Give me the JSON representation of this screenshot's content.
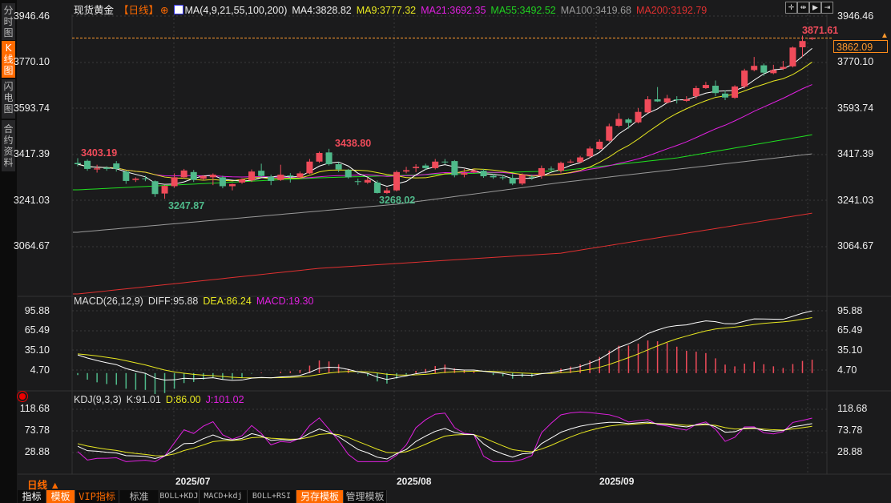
{
  "sidebar": {
    "tabs": [
      "分时图",
      "K线图",
      "闪电图",
      "合约资料"
    ],
    "active": 1
  },
  "header": {
    "instrument": "现货黄金",
    "period": "【日线】",
    "ma_label": "MA(4,9,21,55,100,200)",
    "ma4": "MA4:3828.82",
    "ma9": "MA9:3777.32",
    "ma21": "MA21:3692.35",
    "ma55": "MA55:3492.52",
    "ma100": "MA100:3419.68",
    "ma200": "MA200:3192.79"
  },
  "toolbar_icons": [
    "crosshair-icon",
    "zoom-range-icon",
    "play-icon",
    "jump-end-icon"
  ],
  "colors": {
    "up": "#f04b5a",
    "down": "#4fb98a",
    "ma4": "#ffffff",
    "ma9": "#e8e820",
    "ma21": "#e020e0",
    "ma55": "#20e020",
    "ma100": "#9a9a9a",
    "ma200": "#e03030",
    "accent": "#ff6a00"
  },
  "price_axis": {
    "ticks": [
      "3946.46",
      "3770.10",
      "3593.74",
      "3417.39",
      "3241.03",
      "3064.67"
    ],
    "current": "3862.09"
  },
  "annotations": {
    "high1": "3403.19",
    "high2": "3438.80",
    "low1": "3247.87",
    "low2": "3268.02",
    "high3": "3871.61"
  },
  "macd": {
    "label": "MACD(26,12,9)",
    "diff": "DIFF:95.88",
    "dea": "DEA:86.24",
    "macd": "MACD:19.30",
    "ticks": [
      "95.88",
      "65.49",
      "35.10",
      "4.70"
    ]
  },
  "kdj": {
    "label": "KDJ(9,3,3)",
    "k": "K:91.01",
    "d": "D:86.00",
    "j": "J:101.02",
    "ticks": [
      "118.68",
      "73.78",
      "28.88"
    ]
  },
  "dates": [
    "2025/07",
    "2025/08",
    "2025/09"
  ],
  "period_selector": "日线 ▲",
  "bottom_tabs": [
    "指标",
    "模板",
    "VIP指标",
    "标准",
    "BOLL+KDJ",
    "MACD+kdj",
    "BOLL+RSI",
    "另存模板",
    "管理模板"
  ],
  "chart_data": {
    "type": "candlestick",
    "title": "现货黄金 日线",
    "ylim": [
      2850,
      3960
    ],
    "candles_ohlc": [
      [
        3385,
        3403.19,
        3372,
        3380
      ],
      [
        3393,
        3398,
        3355,
        3362
      ],
      [
        3360,
        3378,
        3348,
        3364
      ],
      [
        3367,
        3372,
        3355,
        3362
      ],
      [
        3383,
        3392,
        3352,
        3362
      ],
      [
        3352,
        3356,
        3305,
        3316
      ],
      [
        3320,
        3330,
        3312,
        3325
      ],
      [
        3326,
        3336,
        3315,
        3324
      ],
      [
        3315,
        3318,
        3255,
        3266
      ],
      [
        3268,
        3300,
        3247.87,
        3297
      ],
      [
        3296,
        3345,
        3290,
        3330
      ],
      [
        3330,
        3362,
        3325,
        3356
      ],
      [
        3350,
        3358,
        3312,
        3320
      ],
      [
        3325,
        3338,
        3318,
        3335
      ],
      [
        3330,
        3345,
        3300,
        3340
      ],
      [
        3330,
        3336,
        3288,
        3296
      ],
      [
        3296,
        3306,
        3280,
        3304
      ],
      [
        3310,
        3326,
        3305,
        3322
      ],
      [
        3318,
        3360,
        3312,
        3352
      ],
      [
        3355,
        3382,
        3330,
        3335
      ],
      [
        3332,
        3340,
        3300,
        3316
      ],
      [
        3320,
        3378,
        3316,
        3340
      ],
      [
        3337,
        3346,
        3310,
        3333
      ],
      [
        3330,
        3352,
        3325,
        3345
      ],
      [
        3345,
        3400,
        3342,
        3390
      ],
      [
        3390,
        3428,
        3385,
        3423
      ],
      [
        3425,
        3438.8,
        3375,
        3380
      ],
      [
        3380,
        3388,
        3350,
        3360
      ],
      [
        3358,
        3362,
        3325,
        3330
      ],
      [
        3315,
        3325,
        3300,
        3312
      ],
      [
        3310,
        3328,
        3305,
        3320
      ],
      [
        3310,
        3318,
        3268.02,
        3270
      ],
      [
        3270,
        3290,
        3266,
        3280
      ],
      [
        3280,
        3356,
        3276,
        3350
      ],
      [
        3352,
        3370,
        3345,
        3357
      ],
      [
        3365,
        3380,
        3350,
        3370
      ],
      [
        3375,
        3382,
        3358,
        3365
      ],
      [
        3365,
        3400,
        3360,
        3390
      ],
      [
        3390,
        3400,
        3380,
        3388
      ],
      [
        3392,
        3396,
        3330,
        3338
      ],
      [
        3340,
        3362,
        3330,
        3346
      ],
      [
        3350,
        3362,
        3345,
        3356
      ],
      [
        3355,
        3362,
        3328,
        3334
      ],
      [
        3336,
        3343,
        3324,
        3330
      ],
      [
        3330,
        3338,
        3320,
        3328
      ],
      [
        3328,
        3342,
        3300,
        3306
      ],
      [
        3306,
        3345,
        3300,
        3340
      ],
      [
        3332,
        3340,
        3320,
        3330
      ],
      [
        3335,
        3375,
        3325,
        3365
      ],
      [
        3363,
        3372,
        3355,
        3362
      ],
      [
        3355,
        3390,
        3348,
        3385
      ],
      [
        3388,
        3398,
        3384,
        3390
      ],
      [
        3388,
        3412,
        3385,
        3406
      ],
      [
        3410,
        3448,
        3405,
        3440
      ],
      [
        3438,
        3475,
        3434,
        3466
      ],
      [
        3470,
        3535,
        3466,
        3525
      ],
      [
        3527,
        3575,
        3522,
        3553
      ],
      [
        3551,
        3556,
        3516,
        3538
      ],
      [
        3540,
        3595,
        3536,
        3580
      ],
      [
        3578,
        3640,
        3575,
        3628
      ],
      [
        3628,
        3675,
        3618,
        3620
      ],
      [
        3616,
        3645,
        3612,
        3632
      ],
      [
        3628,
        3640,
        3612,
        3625
      ],
      [
        3622,
        3640,
        3618,
        3628
      ],
      [
        3640,
        3680,
        3630,
        3671
      ],
      [
        3671,
        3695,
        3668,
        3683
      ],
      [
        3680,
        3700,
        3640,
        3652
      ],
      [
        3650,
        3662,
        3625,
        3635
      ],
      [
        3634,
        3682,
        3630,
        3677
      ],
      [
        3677,
        3745,
        3670,
        3738
      ],
      [
        3740,
        3790,
        3735,
        3756
      ],
      [
        3758,
        3765,
        3718,
        3730
      ],
      [
        3728,
        3760,
        3724,
        3740
      ],
      [
        3745,
        3775,
        3740,
        3752
      ],
      [
        3754,
        3830,
        3750,
        3826
      ],
      [
        3827,
        3871.61,
        3790,
        3851
      ],
      [
        3860,
        3866,
        3855,
        3862.09
      ]
    ],
    "computed_ma": [
      4,
      9,
      21
    ],
    "ma_long_keyframes": {
      "ma55": [
        [
          0,
          3282
        ],
        [
          25,
          3328
        ],
        [
          50,
          3355
        ],
        [
          62,
          3404
        ],
        [
          76,
          3492.52
        ]
      ],
      "ma100": [
        [
          0,
          3120
        ],
        [
          33,
          3227
        ],
        [
          50,
          3310
        ],
        [
          76,
          3419.68
        ]
      ],
      "ma200": [
        [
          0,
          2884
        ],
        [
          25,
          2982
        ],
        [
          50,
          3040
        ],
        [
          76,
          3192.79
        ]
      ]
    },
    "macd_seed": {
      "diff": 32,
      "dea": 30
    },
    "macd_ylim": [
      -20,
      100
    ],
    "kdj_ylim": [
      10,
      125
    ]
  }
}
